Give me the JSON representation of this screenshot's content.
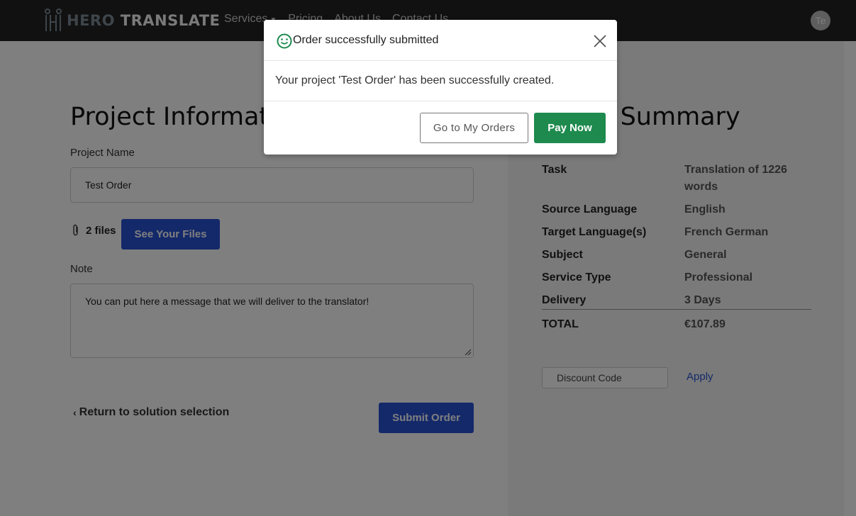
{
  "navbar": {
    "logo_hero": "HERO",
    "logo_translate": "TRANSLATE",
    "links": [
      "Services",
      "Pricing",
      "About Us",
      "Contact Us"
    ],
    "avatar_initials": "Te"
  },
  "project": {
    "title": "Project Information",
    "name_label": "Project Name",
    "name_value": "Test Order",
    "files_count": "2 files",
    "see_files_label": "See Your Files",
    "note_label": "Note",
    "note_value": "You can put here a message that we will deliver to the translator!",
    "back_label": "Return to solution selection",
    "submit_label": "Submit Order"
  },
  "summary": {
    "title": "Order Summary",
    "rows": [
      {
        "key": "Task",
        "value": "Translation of 1226 words"
      },
      {
        "key": "Source Language",
        "value": "English"
      },
      {
        "key": "Target Language(s)",
        "value": "French German"
      },
      {
        "key": "Subject",
        "value": "General"
      },
      {
        "key": "Service Type",
        "value": "Professional"
      },
      {
        "key": "Delivery",
        "value": "3 Days"
      }
    ],
    "total_key": "TOTAL",
    "total_value": "€107.89",
    "discount_placeholder": "Discount Code",
    "apply_label": "Apply"
  },
  "modal": {
    "title": "Order successfully submitted",
    "message": "Your project 'Test Order' has been successfully created.",
    "orders_button": "Go to My Orders",
    "pay_button": "Pay Now"
  },
  "colors": {
    "primary": "#2952d4",
    "success": "#1e8a4e",
    "navbar": "#222222"
  }
}
